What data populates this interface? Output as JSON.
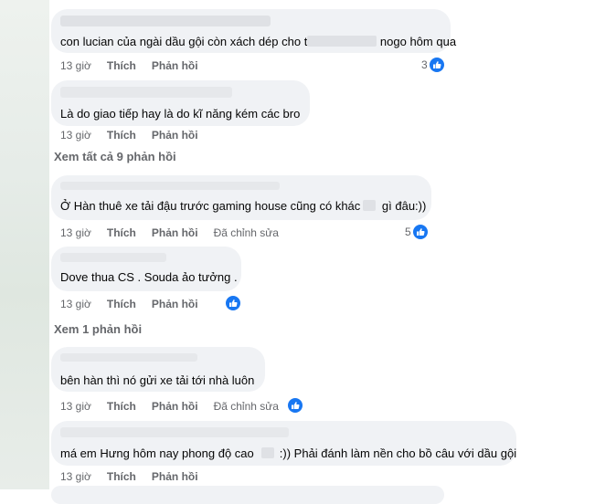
{
  "comments": [
    {
      "text": "con lucian của ngài dầu gội còn xách dép cho t",
      "text_after": " nogo hôm qua",
      "time": "13 giờ",
      "like": "Thích",
      "reply": "Phản hồi",
      "edited": "",
      "reactions": "3"
    },
    {
      "text": "Là do giao tiếp hay là do kĩ năng kém các bro",
      "time": "13 giờ",
      "like": "Thích",
      "reply": "Phản hồi",
      "edited": "",
      "reactions": ""
    },
    {
      "text": "Ở Hàn thuê xe tải đậu trước gaming house cũng có khác",
      "text_after": " gì đâu:))",
      "time": "13 giờ",
      "like": "Thích",
      "reply": "Phản hồi",
      "edited": "Đã chỉnh sửa",
      "reactions": "5"
    },
    {
      "text": "Dove thua CS . Souda ảo tưởng .",
      "time": "13 giờ",
      "like": "Thích",
      "reply": "Phản hồi",
      "edited": "",
      "reactions": ""
    },
    {
      "text": "bên hàn thì nó gửi xe tải tới nhà luôn",
      "time": "13 giờ",
      "like": "Thích",
      "reply": "Phản hồi",
      "edited": "Đã chỉnh sửa",
      "reactions": ""
    },
    {
      "text": "má em Hưng hôm nay phong độ cao",
      "text_after": ":)) Phải đánh làm nền cho bồ câu với dầu gội",
      "time": "13 giờ",
      "like": "Thích",
      "reply": "Phản hồi",
      "edited": "",
      "reactions": ""
    }
  ],
  "view_replies": [
    "Xem tất cả 9 phản hồi",
    "Xem 1 phản hồi"
  ],
  "colors": {
    "bubble": "#f0f2f5",
    "meta_text": "#65676b",
    "like_blue": "#1877f2"
  },
  "icons": {
    "reaction": "like-thumbs-up-icon"
  }
}
